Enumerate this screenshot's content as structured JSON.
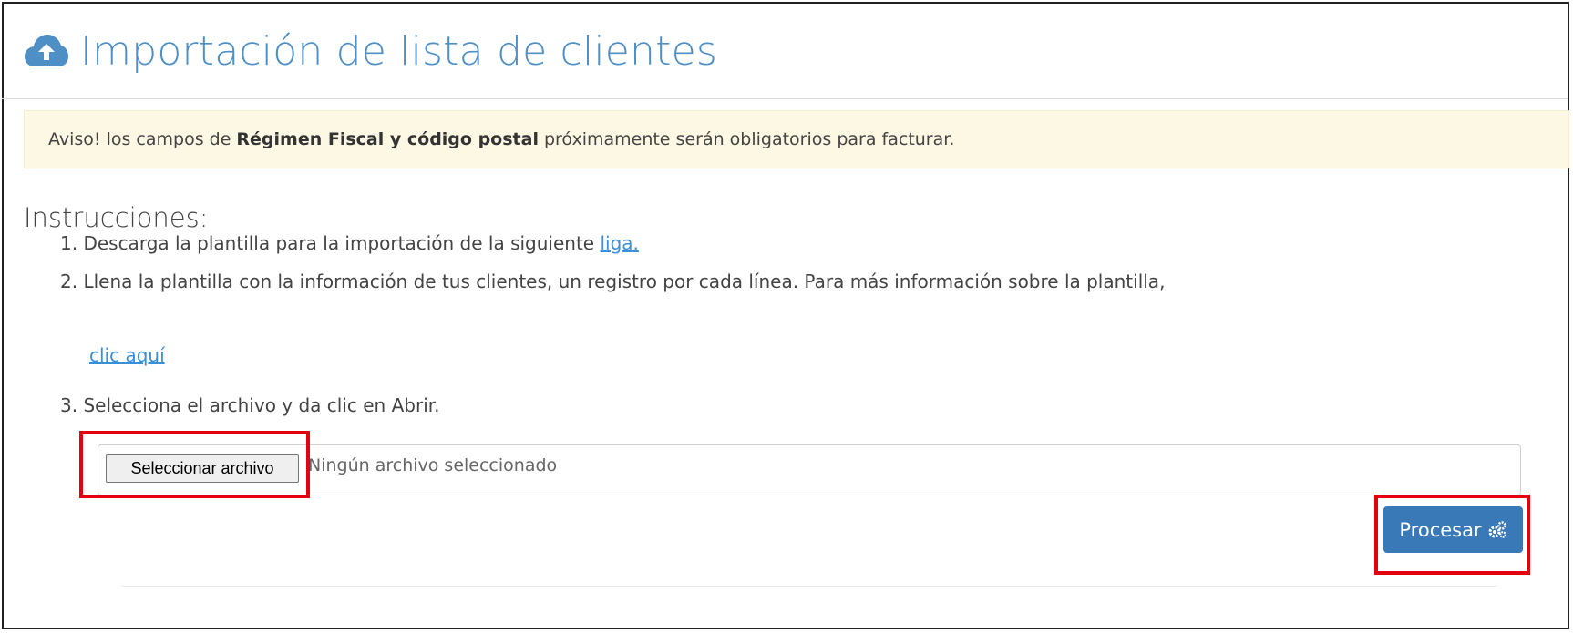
{
  "header": {
    "icon": "cloud-upload-icon",
    "title": "Importación de lista de clientes",
    "accent_color": "#4e8fc5"
  },
  "alert": {
    "prefix": "Aviso! los campos de",
    "bold": "Régimen Fiscal y código postal",
    "suffix": "próximamente serán obligatorios para facturar.",
    "background": "#fcf8e3"
  },
  "instructions": {
    "title": "Instrucciones:",
    "step1_text": "1. Descarga la plantilla para la importación de la siguiente",
    "step1_link": "liga.",
    "step2_text": "2. Llena la plantilla con la información de tus clientes, un registro por cada línea. Para más información sobre la plantilla,",
    "step2_link": "clic aquí",
    "step3_text": "3. Selecciona el archivo y da clic en Abrir."
  },
  "file_input": {
    "button_label": "Seleccionar archivo",
    "status": "Ningún archivo seleccionado"
  },
  "process_button": {
    "label": "Procesar",
    "icon": "gears-icon",
    "color": "#3a79b8"
  },
  "highlight_color": "#e3000f"
}
